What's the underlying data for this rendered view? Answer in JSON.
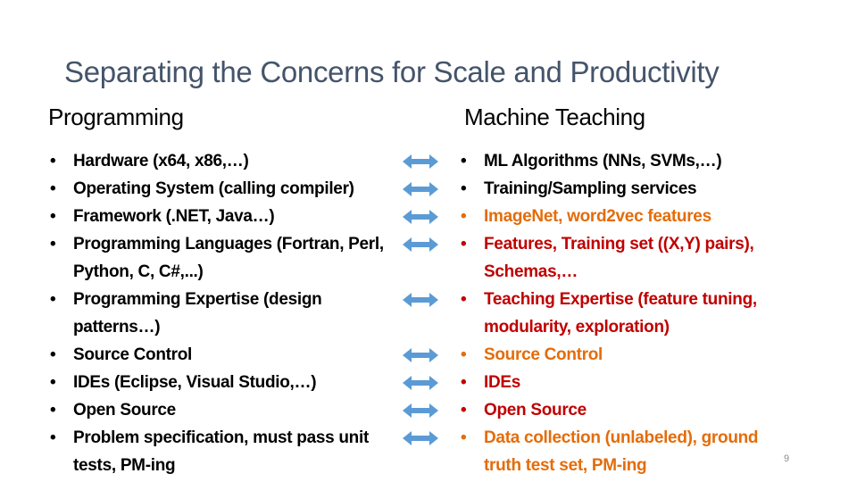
{
  "slide": {
    "title": "Separating the Concerns for Scale and Productivity",
    "page_number": "9",
    "colors": {
      "title": "#44546A",
      "arrow": "#5B9BD5",
      "orange": "#E46C0A",
      "red": "#C00000",
      "black": "#000000"
    }
  },
  "left": {
    "heading": "Programming",
    "items": [
      {
        "text": "Hardware (x64, x86,…)",
        "color": "black"
      },
      {
        "text": "Operating System (calling compiler)",
        "color": "black"
      },
      {
        "text": "Framework (.NET, Java…)",
        "color": "black"
      },
      {
        "text": "Programming Languages (Fortran, Perl, Python, C, C#,...)",
        "color": "black"
      },
      {
        "text": "Programming Expertise (design patterns…)",
        "color": "black"
      },
      {
        "text": "Source Control",
        "color": "black"
      },
      {
        "text": "IDEs (Eclipse, Visual Studio,…)",
        "color": "black"
      },
      {
        "text": "Open Source",
        "color": "black"
      },
      {
        "text": "Problem specification, must pass unit tests, PM-ing",
        "color": "black"
      }
    ]
  },
  "right": {
    "heading": "Machine Teaching",
    "items": [
      {
        "text": "ML Algorithms (NNs, SVMs,…)",
        "color": "black"
      },
      {
        "text": "Training/Sampling services",
        "color": "black"
      },
      {
        "text": "ImageNet, word2vec features",
        "color": "orange"
      },
      {
        "text": "Features, Training set ((X,Y) pairs), Schemas,…",
        "color": "red"
      },
      {
        "text": "Teaching Expertise (feature tuning, modularity, exploration)",
        "color": "red"
      },
      {
        "text": "Source Control",
        "color": "orange"
      },
      {
        "text": "IDEs",
        "color": "red"
      },
      {
        "text": "Open Source",
        "color": "red"
      },
      {
        "text": "Data collection (unlabeled), ground truth test set, PM-ing",
        "color": "orange"
      }
    ]
  },
  "arrows": {
    "icon": "double-headed-arrow",
    "count": 9
  },
  "bullet_glyph": "•"
}
